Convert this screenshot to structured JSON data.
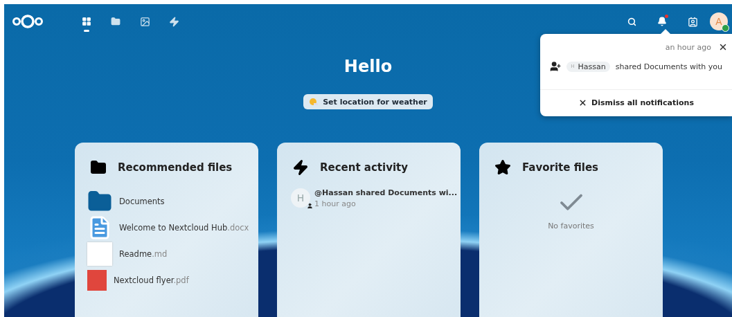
{
  "header": {
    "apps": [
      {
        "kind": "dashboard",
        "selected": true
      },
      {
        "kind": "files",
        "selected": false
      },
      {
        "kind": "photos",
        "selected": false
      },
      {
        "kind": "activity",
        "selected": false
      }
    ],
    "avatar": {
      "initial": "A",
      "online": true
    }
  },
  "greeting": "Hello",
  "weather_button": "Set location for weather",
  "widgets": [
    {
      "kind": "recommended",
      "title": "Recommended files",
      "files": [
        {
          "kind": "folder",
          "name": "Documents"
        },
        {
          "kind": "doc",
          "name": "Welcome to Nextcloud Hub",
          "ext": ".docx"
        },
        {
          "kind": "text",
          "name": "Readme",
          "ext": ".md"
        },
        {
          "kind": "pdf",
          "name": "Nextcloud flyer",
          "ext": ".pdf"
        }
      ]
    },
    {
      "kind": "activity",
      "title": "Recent activity",
      "items": [
        {
          "avatar": "H",
          "text": "@Hassan shared Documents wi...",
          "time": "1 hour ago"
        }
      ]
    },
    {
      "kind": "favorites",
      "title": "Favorite files",
      "empty": "No favorites"
    }
  ],
  "notifications": {
    "time": "an hour ago",
    "user_initial": "H",
    "user": "Hassan",
    "message": "shared Documents with you",
    "dismiss_all": "Dismiss all notifications"
  }
}
